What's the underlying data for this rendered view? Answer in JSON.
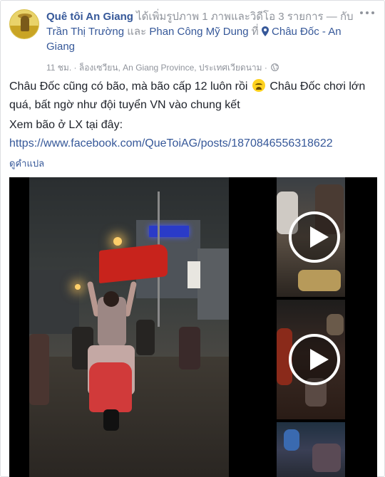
{
  "post": {
    "page_name": "Quê tôi An Giang",
    "action_text": "ได้เพิ่มรูปภาพ 1 ภาพและวิดีโอ 3 รายการ",
    "with_prefix": "— กับ",
    "tagged_1": "Trần Thị Trường",
    "and_text": "และ",
    "tagged_2": "Phan Công Mỹ Dung",
    "at_text": "ที่",
    "location": "Châu Đốc - An Giang",
    "time": "11 ชม.",
    "meta_sep": "·",
    "place": "ล็องเซวียน, An Giang Province, ประเทศเวียดนาม",
    "privacy_icon": "globe-icon"
  },
  "body": {
    "line1a": "Châu Đốc cũng có bão, mà bão cấp 12 luôn rồi",
    "line1b": "Châu Đốc chơi lớn quá, bất ngờ như đội tuyển VN vào chung kết",
    "line2": "Xem bão ở LX tại đây:",
    "url": "https://www.facebook.com/QueToiAG/posts/1870846556318622",
    "emoji_icon": "crying-face-icon"
  },
  "translate_label": "ดูคำแปล",
  "colors": {
    "link": "#365899",
    "meta": "#90949c",
    "flag": "#c8231c"
  }
}
